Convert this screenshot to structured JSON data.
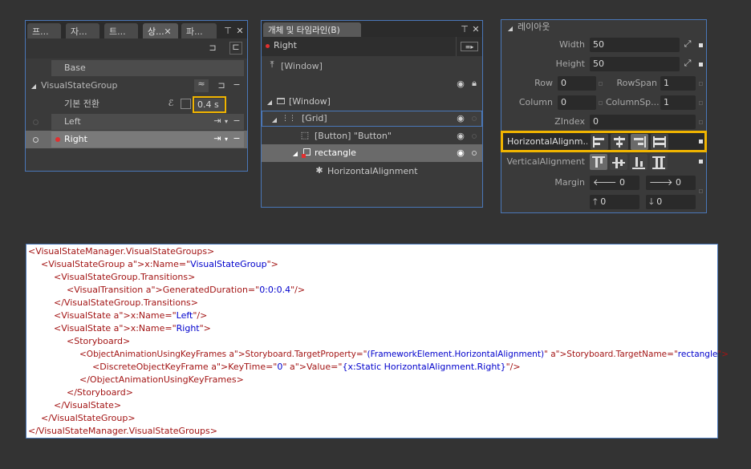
{
  "states_panel": {
    "tabs": [
      "프...",
      "자...",
      "트...",
      "상...",
      "파..."
    ],
    "base_label": "Base",
    "group_name": "VisualStateGroup",
    "default_transition_label": "기본 전환",
    "default_transition_value": "0.4 s",
    "states": [
      "Left",
      "Right"
    ]
  },
  "objects_panel": {
    "title": "개체 및 타임라인(B)",
    "state_label": "Right",
    "window_root": "[Window]",
    "tree": {
      "window": "[Window]",
      "grid": "[Grid]",
      "button": "[Button] \"Button\"",
      "rectangle": "rectangle",
      "property": "HorizontalAlignment"
    }
  },
  "layout_panel": {
    "section": "레이아웃",
    "width_label": "Width",
    "width_value": "50",
    "height_label": "Height",
    "height_value": "50",
    "row_label": "Row",
    "row_value": "0",
    "rowspan_label": "RowSpan",
    "rowspan_value": "1",
    "column_label": "Column",
    "column_value": "0",
    "columnspan_label": "ColumnSp...",
    "columnspan_value": "1",
    "zindex_label": "ZIndex",
    "zindex_value": "0",
    "halign_label": "HorizontalAlignm...",
    "valign_label": "VerticalAlignment",
    "margin_label": "Margin",
    "margin_left": "0",
    "margin_right": "0",
    "margin_top": "0",
    "margin_bottom": "0",
    "halign_selected": "Right",
    "valign_selected": "Stretch"
  },
  "xaml": {
    "lines": [
      "<VisualStateManager.VisualStateGroups>",
      "<VisualStateGroup x:Name=\"VisualStateGroup\">",
      "<VisualStateGroup.Transitions>",
      "<VisualTransition GeneratedDuration=\"0:0:0.4\"/>",
      "</VisualStateGroup.Transitions>",
      "<VisualState x:Name=\"Left\"/>",
      "<VisualState x:Name=\"Right\">",
      "<Storyboard>",
      "<ObjectAnimationUsingKeyFrames Storyboard.TargetProperty=\"(FrameworkElement.HorizontalAlignment)\" Storyboard.TargetName=\"rectangle\">",
      "<DiscreteObjectKeyFrame KeyTime=\"0\" Value=\"{x:Static HorizontalAlignment.Right}\"/>",
      "</ObjectAnimationUsingKeyFrames>",
      "</Storyboard>",
      "</VisualState>",
      "</VisualStateGroup>",
      "</VisualStateManager.VisualStateGroups>"
    ]
  },
  "colors": {
    "highlight_border": "#f0b400",
    "panel_border": "#4a77b8",
    "record_red": "#e03030"
  }
}
